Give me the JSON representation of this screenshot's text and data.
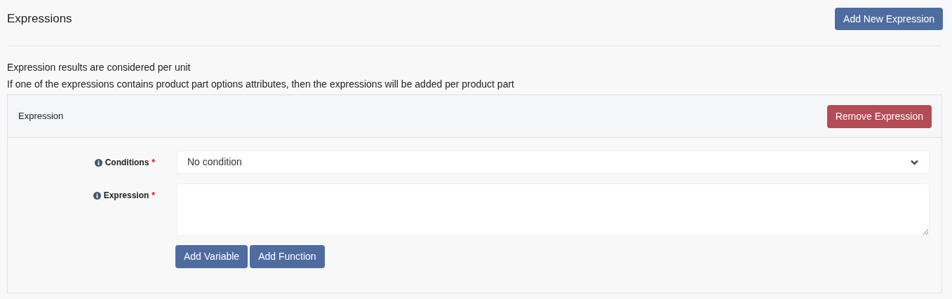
{
  "header": {
    "title": "Expressions",
    "add_button": "Add New Expression"
  },
  "notes": [
    "Expression results are considered per unit",
    "If one of the expressions contains product part options attributes, then the expressions will be added per product part"
  ],
  "card": {
    "title": "Expression",
    "remove_button": "Remove Expression",
    "fields": [
      {
        "kind": "select",
        "label": "Conditions",
        "required_mark": "*",
        "value": "No condition"
      },
      {
        "kind": "textarea",
        "label": "Expression",
        "required_mark": "*"
      }
    ],
    "buttons": [
      "Add Variable",
      "Add Function"
    ]
  }
}
